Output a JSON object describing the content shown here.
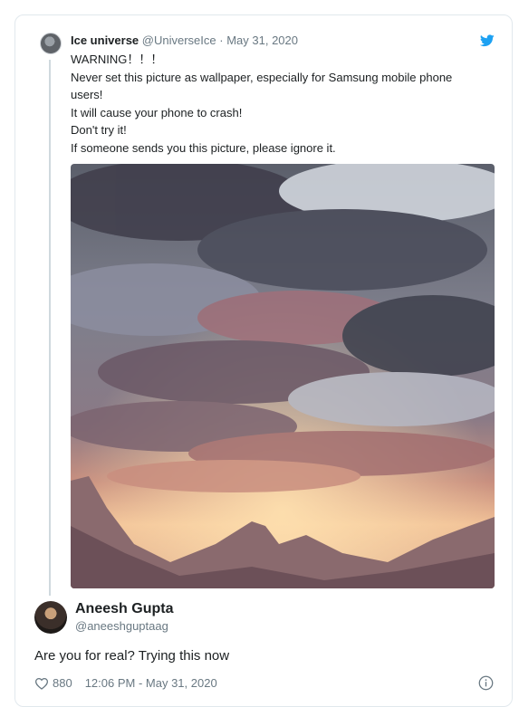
{
  "quoted_tweet": {
    "author_name": "Ice universe",
    "handle": "@UniverseIce",
    "separator": "·",
    "date": "May 31, 2020",
    "lines": [
      "WARNING！！！",
      "Never set this picture as wallpaper, especially for Samsung mobile phone",
      "users!",
      "It will cause your phone to crash!",
      "Don't try it!",
      "If someone sends you this picture, please ignore it."
    ]
  },
  "reply": {
    "author_name": "Aneesh Gupta",
    "handle": "@aneeshguptaag",
    "text": "Are you for real? Trying this now",
    "likes": "880",
    "timestamp": "12:06 PM - May 31, 2020"
  },
  "icons": {
    "brand": "twitter-bird-icon",
    "like": "heart-icon",
    "info": "info-icon"
  },
  "colors": {
    "twitter_blue": "#1da1f2",
    "secondary_text": "#697882",
    "border": "#e1e8ed"
  }
}
